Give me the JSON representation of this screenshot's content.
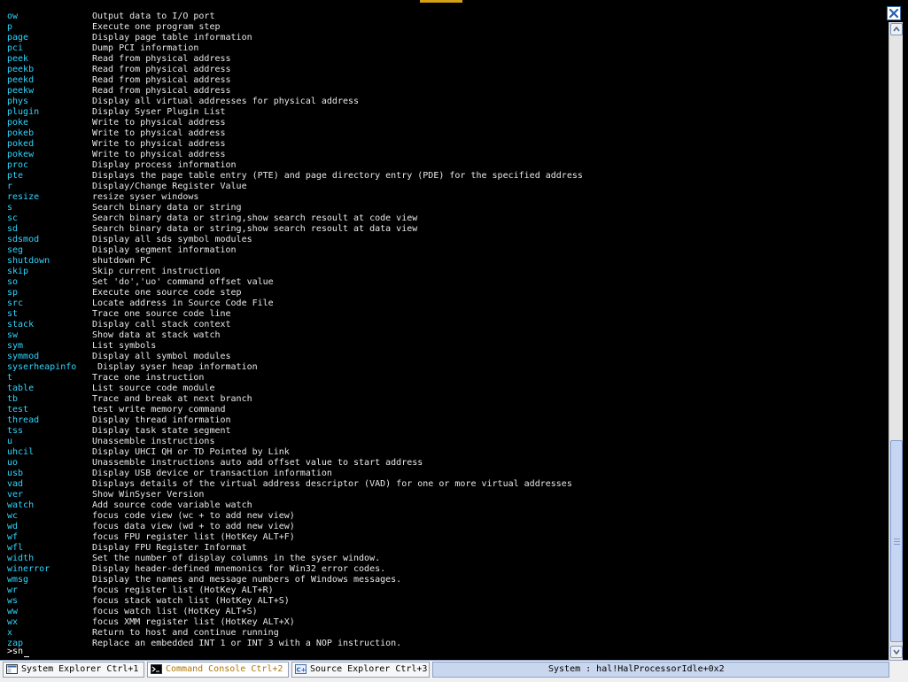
{
  "commands": [
    {
      "cmd": "ow",
      "desc": "Output data to I/O port"
    },
    {
      "cmd": "p",
      "desc": "Execute one program step"
    },
    {
      "cmd": "page",
      "desc": "Display page table information"
    },
    {
      "cmd": "pci",
      "desc": "Dump PCI information"
    },
    {
      "cmd": "peek",
      "desc": "Read from physical address"
    },
    {
      "cmd": "peekb",
      "desc": "Read from physical address"
    },
    {
      "cmd": "peekd",
      "desc": "Read from physical address"
    },
    {
      "cmd": "peekw",
      "desc": "Read from physical address"
    },
    {
      "cmd": "phys",
      "desc": "Display all virtual addresses for physical address"
    },
    {
      "cmd": "plugin",
      "desc": "Display Syser Plugin List"
    },
    {
      "cmd": "poke",
      "desc": "Write to physical address"
    },
    {
      "cmd": "pokeb",
      "desc": "Write to physical address"
    },
    {
      "cmd": "poked",
      "desc": "Write to physical address"
    },
    {
      "cmd": "pokew",
      "desc": "Write to physical address"
    },
    {
      "cmd": "proc",
      "desc": "Display process information"
    },
    {
      "cmd": "pte",
      "desc": "Displays the page table entry (PTE) and page directory entry (PDE) for the specified address"
    },
    {
      "cmd": "r",
      "desc": "Display/Change Register Value"
    },
    {
      "cmd": "resize",
      "desc": "resize syser windows"
    },
    {
      "cmd": "s",
      "desc": "Search binary data or string"
    },
    {
      "cmd": "sc",
      "desc": "Search binary data or string,show search resoult at code view"
    },
    {
      "cmd": "sd",
      "desc": "Search binary data or string,show search resoult at data view"
    },
    {
      "cmd": "sdsmod",
      "desc": "Display all sds symbol modules"
    },
    {
      "cmd": "seg",
      "desc": "Display segment information"
    },
    {
      "cmd": "shutdown",
      "desc": "shutdown PC"
    },
    {
      "cmd": "skip",
      "desc": "Skip current instruction"
    },
    {
      "cmd": "so",
      "desc": "Set 'do','uo' command offset value"
    },
    {
      "cmd": "sp",
      "desc": "Execute one source code step"
    },
    {
      "cmd": "src",
      "desc": "Locate address in Source Code File"
    },
    {
      "cmd": "st",
      "desc": "Trace one source code line"
    },
    {
      "cmd": "stack",
      "desc": "Display call stack context"
    },
    {
      "cmd": "sw",
      "desc": "Show data at stack watch"
    },
    {
      "cmd": "sym",
      "desc": "List symbols"
    },
    {
      "cmd": "symmod",
      "desc": "Display all symbol modules"
    },
    {
      "cmd": "syserheapinfo",
      "desc": " Display syser heap information"
    },
    {
      "cmd": "t",
      "desc": "Trace one instruction"
    },
    {
      "cmd": "table",
      "desc": "List source code module"
    },
    {
      "cmd": "tb",
      "desc": "Trace and break at next branch"
    },
    {
      "cmd": "test",
      "desc": "test write memory command"
    },
    {
      "cmd": "thread",
      "desc": "Display thread information"
    },
    {
      "cmd": "tss",
      "desc": "Display task state segment"
    },
    {
      "cmd": "u",
      "desc": "Unassemble instructions"
    },
    {
      "cmd": "uhcil",
      "desc": "Display UHCI QH or TD Pointed by Link"
    },
    {
      "cmd": "uo",
      "desc": "Unassemble instructions auto add offset value to start address"
    },
    {
      "cmd": "usb",
      "desc": "Display USB device or transaction information"
    },
    {
      "cmd": "vad",
      "desc": "Displays details of the virtual address descriptor (VAD) for one or more virtual addresses"
    },
    {
      "cmd": "ver",
      "desc": "Show WinSyser Version"
    },
    {
      "cmd": "watch",
      "desc": "Add source code variable watch"
    },
    {
      "cmd": "wc",
      "desc": "focus code view (wc + to add new view)"
    },
    {
      "cmd": "wd",
      "desc": "focus data view (wd + to add new view)"
    },
    {
      "cmd": "wf",
      "desc": "focus FPU register list (HotKey ALT+F)"
    },
    {
      "cmd": "wfl",
      "desc": "Display FPU Register Informat"
    },
    {
      "cmd": "width",
      "desc": "Set the number of display columns in the syser window."
    },
    {
      "cmd": "winerror",
      "desc": "Display header-defined mnemonics for Win32 error codes."
    },
    {
      "cmd": "wmsg",
      "desc": "Display the names and message numbers of Windows messages."
    },
    {
      "cmd": "wr",
      "desc": "focus register list (HotKey ALT+R)"
    },
    {
      "cmd": "ws",
      "desc": "focus stack watch list (HotKey ALT+S)"
    },
    {
      "cmd": "ww",
      "desc": "focus watch list (HotKey ALT+S)"
    },
    {
      "cmd": "wx",
      "desc": "focus XMM register list (HotKey ALT+X)"
    },
    {
      "cmd": "x",
      "desc": "Return to host and continue running"
    },
    {
      "cmd": "zap",
      "desc": "Replace an embedded INT 1 or INT 3 with a NOP instruction."
    }
  ],
  "prompt": {
    "input": ">sn"
  },
  "tabs": [
    {
      "label": "System Explorer Ctrl+1"
    },
    {
      "label": "Command Console Ctrl+2"
    },
    {
      "label": "Source Explorer Ctrl+3"
    }
  ],
  "status": {
    "text": "System : hal!HalProcessorIdle+0x2"
  },
  "colors": {
    "command": "#2fd6ff",
    "description": "#e8e8e8",
    "active_tab": "#b07800",
    "background": "#000000"
  },
  "icons": {
    "close": "close-icon",
    "scroll_up": "scroll-up-arrow-icon",
    "scroll_down": "scroll-down-arrow-icon"
  }
}
